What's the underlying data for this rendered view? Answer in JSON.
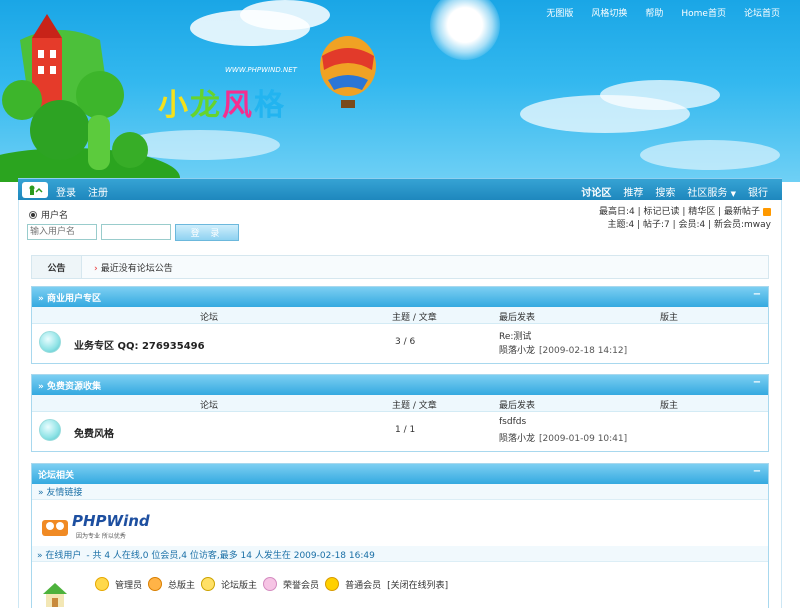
{
  "toplinks": [
    "无图版",
    "风格切换",
    "帮助",
    "Home首页",
    "论坛首页"
  ],
  "logo": {
    "text": "小龙风格",
    "url": "WWW.PHPWIND.NET"
  },
  "navbar": {
    "left": [
      "登录",
      "注册"
    ],
    "right": [
      "讨论区",
      "推荐",
      "搜索",
      "社区服务",
      "银行"
    ]
  },
  "login": {
    "radio_label": "用户名",
    "username_placeholder": "输入用户名",
    "password_value": "",
    "button": "登 录"
  },
  "stats": {
    "line1": "最高日:4 | 标记已读 | 精华区 | 最新帖子",
    "line2": "主题:4 | 帖子:7 | 会员:4 | 新会员:mway"
  },
  "notice": {
    "tag": "公告",
    "text": "最近没有论坛公告"
  },
  "columns": {
    "forum": "论坛",
    "topics": "主题 / 文章",
    "last": "最后发表",
    "mod": "版主"
  },
  "sections": [
    {
      "title": "» 商业用户专区",
      "forums": [
        {
          "name": "业务专区  QQ: 276935496",
          "count": "3 / 6",
          "last_title": "Re:测试",
          "last_author": "陨落小龙",
          "last_date": "[2009-02-18 14:12]"
        }
      ]
    },
    {
      "title": "» 免费资源收集",
      "forums": [
        {
          "name": "免费风格",
          "count": "1 / 1",
          "last_title": "fsdfds",
          "last_author": "陨落小龙",
          "last_date": "[2009-01-09 10:41]"
        }
      ]
    }
  ],
  "related": {
    "title": "论坛相关",
    "friendlinks": "» 友情链接",
    "phpwind_logo": "PHPWind",
    "phpwind_slogan": "因为专业 所以优秀",
    "online": {
      "label": "» 在线用户",
      "text": "- 共  4 人在线,0 位会员,4 位访客,最多  14 人发生在  2009-02-18 16:49"
    },
    "legend": [
      "管理员",
      "总版主",
      "论坛版主",
      "荣誉会员",
      "普通会员"
    ],
    "close_list": "[关闭在线列表]"
  },
  "colors": {
    "nav": "#1e87bd",
    "section_head": "#34a9e0",
    "banner": "#1aa6e6"
  }
}
